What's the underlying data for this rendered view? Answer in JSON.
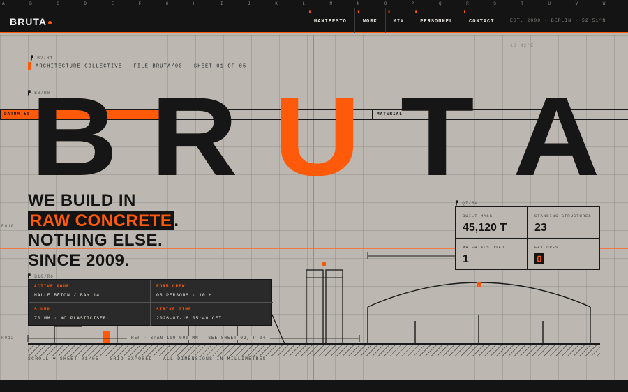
{
  "ruler": {
    "letters": [
      "A",
      "B",
      "C",
      "D",
      "E",
      "F",
      "G",
      "H",
      "I",
      "J",
      "K",
      "L",
      "M",
      "N",
      "O",
      "P",
      "Q",
      "R",
      "S",
      "T",
      "U",
      "V",
      "W"
    ]
  },
  "nav": {
    "logo": "BRUTA",
    "items": [
      {
        "label": "MANIFESTO"
      },
      {
        "label": "WORK"
      },
      {
        "label": "MIX"
      },
      {
        "label": "PERSONNEL"
      },
      {
        "label": "CONTACT"
      }
    ],
    "meta": "EST. 2009 · BERLIN · 52.51°N 13.42°E"
  },
  "refs": {
    "r1": "B2/R1",
    "r2": "B3/R8",
    "r3": "Q7/R4",
    "r4": "B10/R6",
    "m1": "R010",
    "m2": "R012"
  },
  "file_line": "ARCHITECTURE COLLECTIVE — FILE BRUTA/00 — SHEET 01 OF 05",
  "datum": {
    "label": "DATUM ±0",
    "material": "MATERIAL"
  },
  "hero": {
    "letters": [
      "B",
      "R",
      "U",
      "T",
      "A"
    ]
  },
  "headline": {
    "line1": "WE BUILD IN",
    "line2_highlight": "RAW CONCRETE",
    "line2_suffix": ".",
    "line3": "NOTHING ELSE.",
    "line4": "SINCE 2009."
  },
  "stats": {
    "built_mass_label": "BUILT MASS",
    "built_mass_value": "45,120 T",
    "standing_label": "STANDING STRUCTURES",
    "standing_value": "23",
    "materials_label": "MATERIALS USED",
    "materials_value": "1",
    "failures_label": "FAILURES",
    "failures_value": "0"
  },
  "pour": {
    "active_label": "ACTIVE POUR",
    "active_value": "HALLE BÉTON / BAY 14",
    "crew_label": "FORM CREW",
    "crew_value": "08 PERSONS · 10 H",
    "slump_label": "SLUMP",
    "slump_value": "70 MM · NO PLASTICISER",
    "strike_label": "STRIKE TIME",
    "strike_value": "2026-07-18 05:40 CET"
  },
  "ref_span": "REF · SPAN 100 000 MM — SEE SHEET 02, P-04",
  "scroll_line": "SCROLL ▼ SHEET 01/05 — GRID EXPOSED — ALL DIMENSIONS IN MILLIMETRES",
  "colors": {
    "accent": "#ff5a0a",
    "ink": "#141414",
    "paper": "#bcb8b1"
  }
}
